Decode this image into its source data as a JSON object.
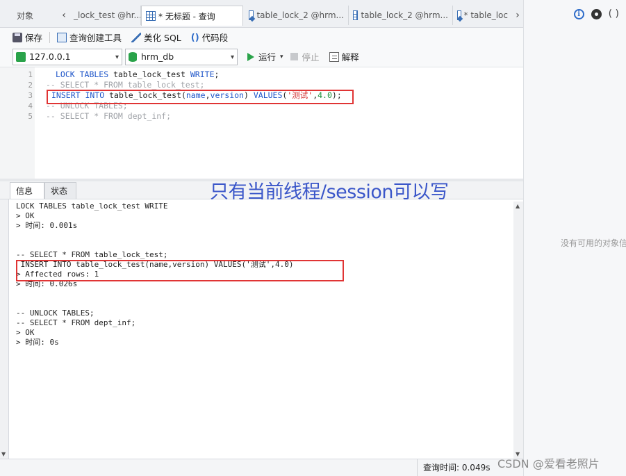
{
  "tabs": [
    {
      "label": "对象",
      "icon": "none",
      "active": false
    },
    {
      "label": "_lock_test @hr...",
      "icon": "table-icon",
      "active": false
    },
    {
      "label": "* 无标题 - 查询",
      "icon": "query-icon",
      "active": true
    },
    {
      "label": "table_lock_2 @hrm...",
      "icon": "query-icon",
      "active": false
    },
    {
      "label": "table_lock_2 @hrm...",
      "icon": "table-icon",
      "active": false
    },
    {
      "label": "* table_loc",
      "icon": "query-icon",
      "active": false
    }
  ],
  "toolbar": {
    "save_label": "保存",
    "builder_label": "查询创建工具",
    "beautify_label": "美化 SQL",
    "snippet_label": "代码段"
  },
  "connection": {
    "host": "127.0.0.1",
    "database": "hrm_db",
    "run_label": "运行",
    "stop_label": "停止",
    "explain_label": "解释"
  },
  "editor": {
    "line_numbers": [
      "1",
      "2",
      "3",
      "4",
      "5"
    ],
    "lines": [
      {
        "parts": [
          [
            "kw",
            "LOCK TABLES "
          ],
          [
            "fn",
            "table_lock_test "
          ],
          [
            "kw",
            "WRITE"
          ],
          [
            "fn",
            ";"
          ]
        ]
      },
      {
        "parts": [
          [
            "cm",
            "-- SELECT * FROM table_lock_test;"
          ]
        ]
      },
      {
        "parts": [
          [
            "kw",
            "INSERT INTO "
          ],
          [
            "fn",
            "table_lock_test("
          ],
          [
            "kw",
            "name"
          ],
          [
            "fn",
            ","
          ],
          [
            "kw",
            "version"
          ],
          [
            "fn",
            ") "
          ],
          [
            "kw",
            "VALUES"
          ],
          [
            "fn",
            "("
          ],
          [
            "str",
            "'测试'"
          ],
          [
            "fn",
            ","
          ],
          [
            "num",
            "4.0"
          ],
          [
            "fn",
            ");"
          ]
        ]
      },
      {
        "parts": [
          [
            "cm",
            "-- UNLOCK TABLES;"
          ]
        ]
      },
      {
        "parts": [
          [
            "cm",
            "-- SELECT * FROM dept_inf;"
          ]
        ]
      }
    ]
  },
  "result_tabs": {
    "info": "信息",
    "status": "状态"
  },
  "overlay_text": "只有当前线程/session可以写",
  "messages": [
    "LOCK TABLES table_lock_test WRITE",
    "> OK",
    "> 时间: 0.001s",
    "",
    "",
    "-- SELECT * FROM table_lock_test;",
    " INSERT INTO table_lock_test(name,version) VALUES('测试',4.0)",
    "> Affected rows: 1",
    "> 时间: 0.026s",
    "",
    "",
    "-- UNLOCK TABLES;",
    "-- SELECT * FROM dept_inf;",
    "> OK",
    "> 时间: 0s"
  ],
  "right_panel": {
    "empty_text": "没有可用的对象信息",
    "paren_glyph": "( )"
  },
  "status": {
    "query_time": "查询时间: 0.049s"
  },
  "watermark": "CSDN @爱看老照片",
  "colors": {
    "keyword": "#1f56c9",
    "string": "#d12b2b",
    "number": "#1c8f3a",
    "comment": "#a0a3a8",
    "highlight_box": "#e03434",
    "overlay": "#3a56c9"
  }
}
